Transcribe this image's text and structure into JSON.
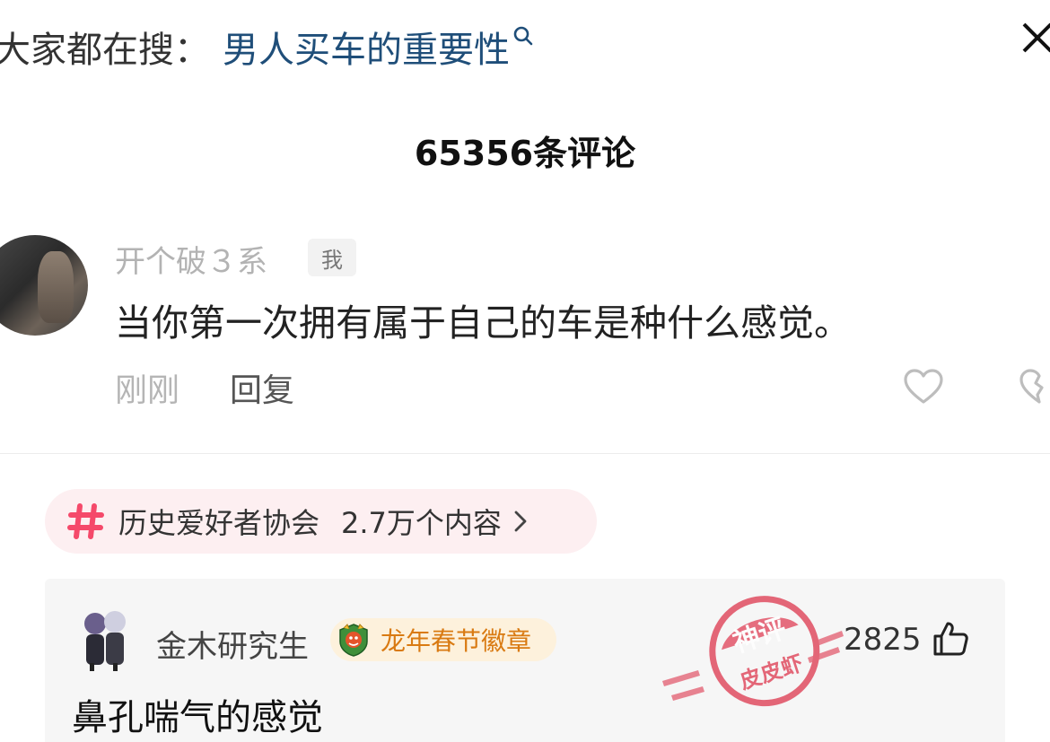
{
  "search": {
    "prefix": "大家都在搜：",
    "term": "男人买车的重要性"
  },
  "comments_header": {
    "count_label": "65356条评论"
  },
  "main_comment": {
    "username": "开个破３系",
    "badge": "我",
    "text": "当你第一次拥有属于自己的车是种什么感觉。",
    "time": "刚刚",
    "reply_label": "回复"
  },
  "topic": {
    "name": "历史爱好者协会",
    "count": "2.7万个内容"
  },
  "hot_comment": {
    "username": "金木研究生",
    "badge_label": "龙年春节徽章",
    "like_count": "2825",
    "text": "鼻孔喘气的感觉"
  },
  "watermark": {
    "line1": "神评",
    "line2": "皮皮虾"
  },
  "colors": {
    "accent_pink": "#f5496a",
    "search_term_blue": "#1f4e79",
    "badge_orange": "#d97a12",
    "watermark_red": "#e0475c"
  },
  "icons": [
    "search-icon",
    "close-icon",
    "heart-icon",
    "broken-heart-icon",
    "hashtag-icon",
    "chevron-right-icon",
    "dragon-badge-icon",
    "thumbs-up-icon"
  ]
}
